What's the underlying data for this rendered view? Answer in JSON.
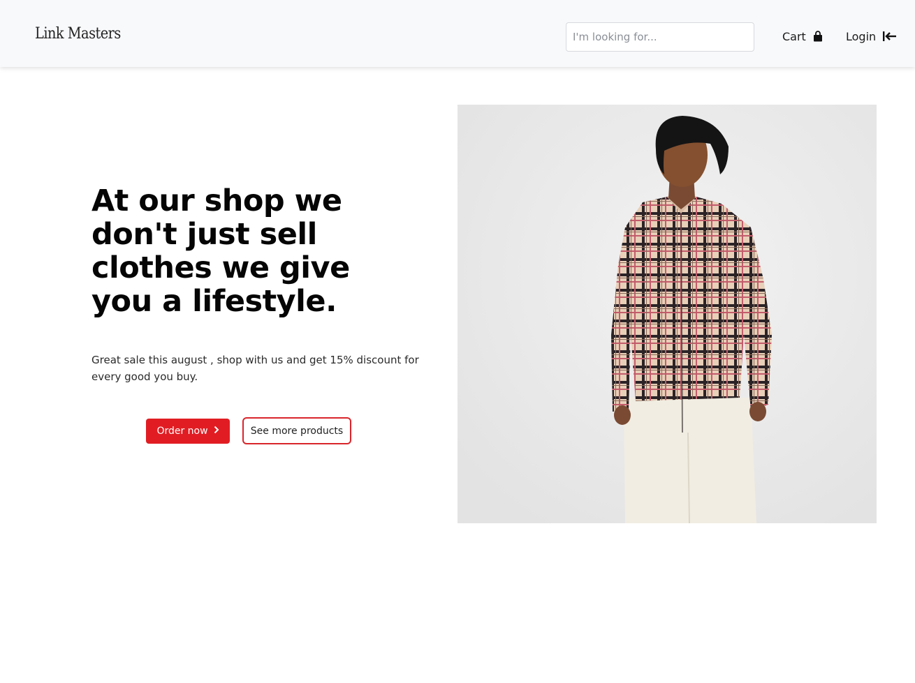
{
  "header": {
    "brand": "Link Masters",
    "search_placeholder": "I'm looking for...",
    "cart_label": "Cart",
    "cart_icon": "shopping-bag-icon",
    "login_label": "Login",
    "login_icon": "sign-in-arrow-icon"
  },
  "hero": {
    "headline": "At our shop we don't just sell clothes we give you a lifestyle.",
    "subtext": "Great sale this august , shop with us and get 15% discount for every good you buy.",
    "primary_button": "Order now",
    "primary_button_icon": "chevron-right-icon",
    "secondary_button": "See more products"
  },
  "colors": {
    "accent": "#e11d23",
    "header_bg": "#f8f9fb"
  }
}
